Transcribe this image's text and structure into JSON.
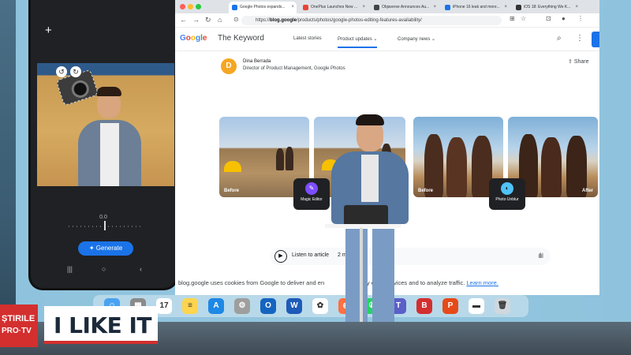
{
  "phone": {
    "plus_icon": "+",
    "slider_label": "0.0",
    "generate_label": "Generate",
    "nav": [
      "|||",
      "○",
      "‹"
    ]
  },
  "browser": {
    "tabs": [
      {
        "title": "Google Photos expands...",
        "fav": "#1a73e8",
        "active": true
      },
      {
        "title": "OnePlus Launches New ...",
        "fav": "#ea4335",
        "active": false
      },
      {
        "title": "Objaverse Announces Au...",
        "fav": "#444444",
        "active": false
      },
      {
        "title": "iPhone 16 leak and more...",
        "fav": "#1a73e8",
        "active": false
      },
      {
        "title": "iOS 18: Everything We K...",
        "fav": "#333333",
        "active": false
      }
    ],
    "url_prefix": "https://",
    "url_domain": "blog.google",
    "url_path": "/products/photos/google-photos-editing-features-availability/"
  },
  "site": {
    "logo_letters": [
      "G",
      "o",
      "o",
      "g",
      "l",
      "e"
    ],
    "title": "The Keyword",
    "nav": [
      "Latest stories",
      "Product updates",
      "Company news"
    ],
    "author_initial": "D",
    "author_name": "Dina Berrada",
    "author_role": "Director of Product Management, Google Photos",
    "share_label": "Share",
    "before_label": "Before",
    "after_label": "After",
    "feature_magic_editor": "Magic Editor",
    "feature_photo_unblur": "Photo Unblur",
    "listen_label": "Listen to article",
    "listen_duration": "2 m",
    "cookie_text": "blog.google uses cookies from Google to deliver and en",
    "cookie_text_end": "uality of its services and to analyze traffic.",
    "cookie_link": "Learn more."
  },
  "dock": {
    "apps": [
      {
        "name": "finder",
        "color": "#4aa3f0",
        "glyph": "☺"
      },
      {
        "name": "launchpad",
        "color": "#8a8a8a",
        "glyph": "▦"
      },
      {
        "name": "calendar",
        "color": "#ffffff",
        "glyph": "17"
      },
      {
        "name": "notes",
        "color": "#ffd54f",
        "glyph": "≡"
      },
      {
        "name": "app-store",
        "color": "#1e88e5",
        "glyph": "A"
      },
      {
        "name": "system-settings",
        "color": "#9e9e9e",
        "glyph": "⚙"
      },
      {
        "name": "outlook",
        "color": "#1565c0",
        "glyph": "O"
      },
      {
        "name": "word",
        "color": "#1e5bb8",
        "glyph": "W"
      },
      {
        "name": "chatgpt",
        "color": "#ffffff",
        "glyph": "✿"
      },
      {
        "name": "firefox",
        "color": "#ff7043",
        "glyph": "◉"
      },
      {
        "name": "whatsapp",
        "color": "#25d366",
        "glyph": "✆"
      },
      {
        "name": "teams",
        "color": "#5b5fc7",
        "glyph": "T"
      },
      {
        "name": "bitdefender",
        "color": "#d32f2f",
        "glyph": "B"
      },
      {
        "name": "powerpoint-like",
        "color": "#e64a19",
        "glyph": "P"
      },
      {
        "name": "screen-capture",
        "color": "#ffffff",
        "glyph": "▬"
      },
      {
        "name": "trash",
        "color": "#cfd8dc",
        "glyph": "🗑"
      }
    ]
  },
  "tv": {
    "logo_line1": "ȘTIRILE",
    "logo_line2": "PRO·TV",
    "banner": "I LIKE IT"
  }
}
